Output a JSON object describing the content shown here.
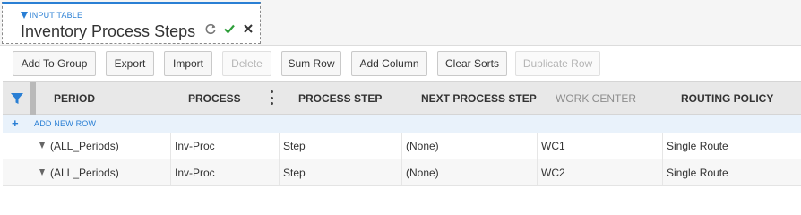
{
  "tab": {
    "kicker": "INPUT TABLE",
    "title": "Inventory Process Steps",
    "accent": "#2a7fd4",
    "icons": [
      "refresh-icon",
      "checkmark-icon",
      "close-icon"
    ]
  },
  "toolbar": {
    "add_to_group": "Add To Group",
    "export": "Export",
    "import": "Import",
    "delete": "Delete",
    "sum_row": "Sum Row",
    "add_column": "Add Column",
    "clear_sorts": "Clear Sorts",
    "duplicate_row": "Duplicate Row"
  },
  "grid": {
    "columns": {
      "period": "PERIOD",
      "process": "PROCESS",
      "process_step": "PROCESS STEP",
      "next_process_step": "NEXT PROCESS STEP",
      "work_center": "WORK CENTER",
      "routing_policy": "ROUTING POLICY"
    },
    "add_new_row": "ADD NEW ROW",
    "rows": [
      {
        "period": "(ALL_Periods)",
        "process": "Inv-Proc",
        "process_step": "Step",
        "next_process_step": "(None)",
        "work_center": "WC1",
        "routing_policy": "Single Route"
      },
      {
        "period": "(ALL_Periods)",
        "process": "Inv-Proc",
        "process_step": "Step",
        "next_process_step": "(None)",
        "work_center": "WC2",
        "routing_policy": "Single Route"
      }
    ]
  },
  "colors": {
    "accent": "#2a7fd4",
    "header_bg": "#e8e8e8",
    "add_row_bg": "#e9f2fb",
    "confirm_green": "#2e9e3a"
  }
}
